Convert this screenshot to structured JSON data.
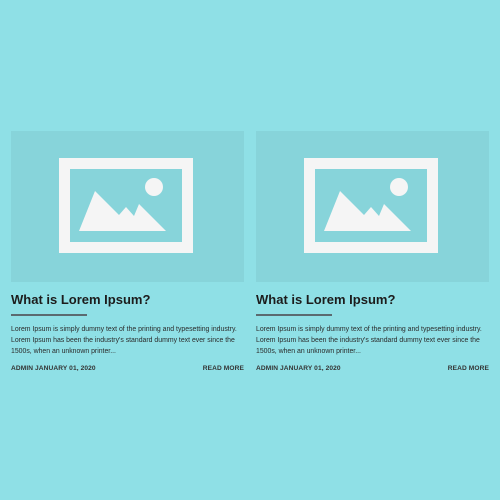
{
  "posts": [
    {
      "image_icon": "image-placeholder-icon",
      "title": "What is Lorem Ipsum?",
      "excerpt": "Lorem Ipsum is simply dummy text of the printing and typesetting industry. Lorem Ipsum has been the industry's standard dummy text ever since the 1500s, when an unknown printer...",
      "meta": "ADMIN JANUARY 01, 2020",
      "read_more": "READ MORE"
    },
    {
      "image_icon": "image-placeholder-icon",
      "title": "What is Lorem Ipsum?",
      "excerpt": "Lorem Ipsum is simply dummy text of the printing and typesetting industry. Lorem Ipsum has been the industry's standard dummy text ever since the 1500s, when an unknown printer...",
      "meta": "ADMIN JANUARY 01, 2020",
      "read_more": "READ MORE"
    }
  ],
  "colors": {
    "background": "#8fe0e6",
    "thumbnail": "#87d4da",
    "icon": "#f5f5f5",
    "rule": "#5b6a70"
  }
}
